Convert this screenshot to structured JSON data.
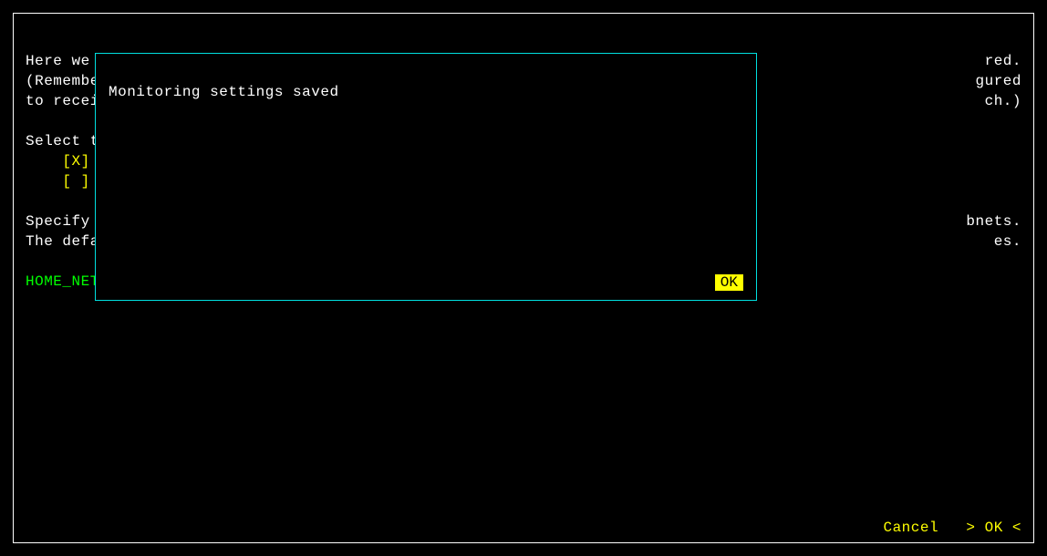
{
  "bg": {
    "line1_left": "Here we",
    "line1_right": "red.",
    "line2_left": "(Remembe",
    "line2_right": "gured",
    "line3_left": "to recei",
    "line3_right": "ch.)",
    "line4_left": "",
    "line4_right": "",
    "line5_left": "Select t",
    "line5_right": "",
    "line6_left": "    [X]",
    "line6_right": "",
    "line7_left": "    [ ]",
    "line7_right": "",
    "line8_left": "",
    "line8_right": "",
    "line9_left": "Specify",
    "line9_right": "bnets.",
    "line10_left": "The defa",
    "line10_right": "es.",
    "line11_left": "",
    "line11_right": "",
    "home_net": "HOME_NET"
  },
  "dialog": {
    "message": "Monitoring settings saved",
    "ok_label": "OK"
  },
  "footer": {
    "cancel_label": "Cancel",
    "ok_label": "> OK <"
  }
}
